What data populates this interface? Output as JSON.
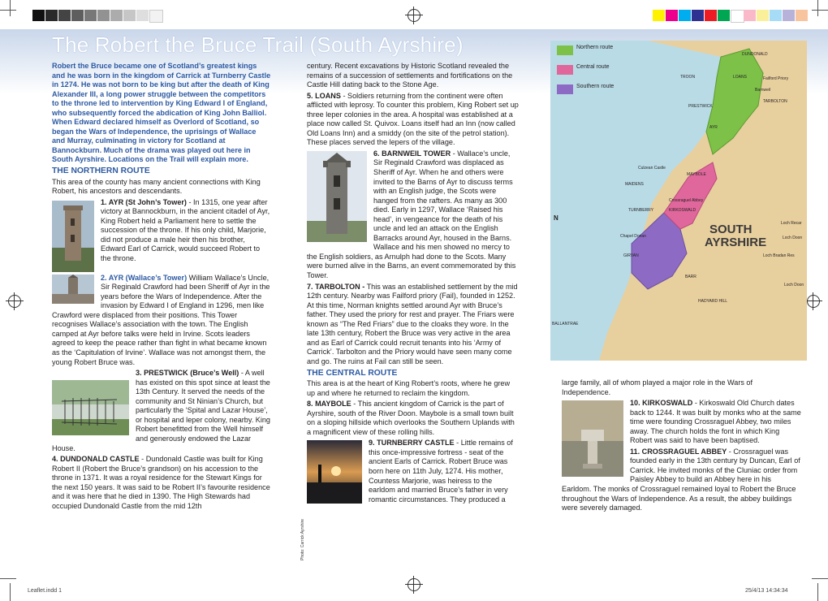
{
  "title": "The Robert the Bruce Trail (South Ayrshire)",
  "intro": "Robert the Bruce became one of Scotland’s greatest kings and he was born in the kingdom of Carrick at Turnberry Castle in 1274. He was not born to be king but after the death of King Alexander III, a long power struggle between the competitors to the throne led to intervention by King Edward I of England, who subsequently forced the abdication of King John Balliol. When Edward declared himself as Overlord of Scotland, so began the Wars of Independence, the uprisings of Wallace and Murray, culminating in victory for Scotland at Bannockburn. Much of the drama was played out here in South Ayrshire. Locations on the Trail will explain more.",
  "northern_heading": "THE NORTHERN ROUTE",
  "northern_intro": "This area of the county has many ancient connections with King Robert, his ancestors and descendants.",
  "ayr_title": "1. AYR (St John’s Tower)",
  "ayr_text": " - In 1315, one year after victory at Bannockburn, in the ancient citadel of Ayr, King Robert held a Parliament here to settle the succession of the throne. If his only child, Marjorie, did not produce a male heir then his brother, Edward Earl of Carrick, would succeed Robert to the throne.",
  "wallace_title": "2. AYR (Wallace’s Tower)",
  "wallace_text": " William Wallace’s Uncle, Sir Reginald Crawford had been Sheriff of Ayr in the years before the Wars of Independence. After the invasion by Edward I of England in 1296, men like Crawford were displaced from their positions. This Tower recognises Wallace’s association with the town. The English camped at Ayr before talks were held in Irvine. Scots leaders agreed to keep the peace rather than fight in what became known as the ‘Capitulation of Irvine’. Wallace was not amongst them, the young Robert Bruce was.",
  "prestwick_title": "3. PRESTWICK (Bruce’s Well)",
  "prestwick_text": " - A well has existed on this spot since at least the 13th Century. It served the needs of the community and St Ninian’s Church, but particularly the ‘Spital and Lazar House’, or hospital and leper colony, nearby. King Robert benefitted from the Well himself and generously endowed the Lazar House.",
  "dundonald_title": "4. DUNDONALD CASTLE",
  "dundonald_text": " - Dundonald Castle was built for King Robert II (Robert the Bruce’s grandson) on his accession to the throne in 1371. It was a royal residence for the Stewart Kings for the next 150 years. It was said to be Robert II’s favourite residence and it was here that he died in 1390. The High Stewards had occupied Dundonald Castle from the mid 12th",
  "col2_top": "century. Recent excavations by Historic Scotland revealed the remains of a succession of settlements and fortifications on the Castle Hill dating back to the Stone Age.",
  "loans_title": "5. LOANS",
  "loans_text": " - Soldiers returning from the continent were often afflicted with leprosy. To counter this problem, King Robert set up three leper colonies in the area. A hospital was established at a place now called St. Quivox. Loans itself had an Inn (now called Old Loans Inn) and a smiddy (on the site of the petrol station). These places served the lepers of the village.",
  "barnweil_title": "6. BARNWEIL TOWER",
  "barnweil_text": " - Wallace’s uncle, Sir Reginald Crawford was displaced as Sheriff of Ayr. When he and others were invited to the Barns of Ayr to discuss terms with an English judge, the Scots were hanged from the rafters. As many as 300 died. Early in 1297, Wallace ‘Raised his head’, in vengeance for the death of his uncle and led an attack on the English Barracks around Ayr, housed in the Barns. Wallace and his men showed no mercy to the English soldiers, as Arnulph had done to the Scots. Many were burned alive in the Barns, an event commemorated by this Tower.",
  "tarbolton_title": "7. TARBOLTON -",
  "tarbolton_text": " This was an established settlement by the mid 12th century. Nearby was Failford priory (Fail), founded in 1252. At this time, Norman knights settled around Ayr with Bruce’s father. They used the priory for rest and prayer. The Friars were known as “The Red Friars” due to the cloaks they wore. In the late 13th century, Robert the Bruce was very active in the area and as Earl of Carrick could recruit tenants into his ‘Army of Carrick’. Tarbolton and the Priory would have seen many come and go. The ruins at Fail can still be seen.",
  "central_heading": "THE CENTRAL ROUTE",
  "central_intro": "This area is at the heart of King Robert’s roots, where he grew up and where he returned to reclaim the kingdom.",
  "maybole_title": "8. MAYBOLE",
  "maybole_text": " - This ancient kingdom of Carrick is the part of Ayrshire, south of the River Doon. Maybole is a small town built on a sloping hillside which overlooks the Southern Uplands with a magnificent view of these rolling hills.",
  "turnberry_title": "9. TURNBERRY CASTLE",
  "turnberry_text": " - Little remains of this once-impressive fortress - seat of the ancient Earls of Carrick. Robert Bruce was born here on 11th July, 1274. His mother, Countess Marjorie, was heiress to the earldom and married Bruce’s father in very romantic circumstances. They produced a",
  "col3_top": "large family, all of whom played a major role in the Wars of Independence.",
  "kirkoswald_title": "10. KIRKOSWALD",
  "kirkoswald_text": " - Kirkoswald Old Church dates back to 1244. It was built by monks who at the same time were founding Crossraguel Abbey, two miles away. The church holds the font in which King Robert was said to have been baptised.",
  "crossraguel_title": "11. CROSSRAGUEL ABBEY",
  "crossraguel_text": " - Crossraguel was founded early in the 13th century by Duncan, Earl of Carrick. He invited monks of the Cluniac order from Paisley Abbey to build an Abbey here in his Earldom. The monks of Crossraguel remained loyal to Robert the Bruce throughout the Wars of Independence. As a result, the abbey buildings were severely damaged.",
  "photo_credit": "Photo: Carrick Ayrshire",
  "footer_left": "Leaflet.indd   1",
  "footer_right": "25/4/13   14:34:34",
  "map": {
    "legend_northern": "Northern route",
    "legend_central": "Central route",
    "legend_southern": "Southern route",
    "north_letter": "N",
    "region_label_1": "SOUTH",
    "region_label_2": "AYRSHIRE",
    "places": [
      "DUNDONALD",
      "TROON",
      "LOANS",
      "Barnweil",
      "Failford Priory",
      "TARBOLTON",
      "PRESTWICK",
      "AYR",
      "Culzean Castle",
      "MAYBOLE",
      "MAIDENS",
      "Crossraguel Abbey",
      "TURNBERRY",
      "KIRKOSWALD",
      "Chapel Donan",
      "GIRVAN",
      "Loch Doon",
      "Loch Bradan Res",
      "BARR",
      "HADYARD HILL",
      "BALLANTRAE",
      "Loch Recar",
      "Loch Doon"
    ]
  },
  "colors": {
    "northern": "#7dc148",
    "central": "#e0679b",
    "southern": "#8d6bc4",
    "land": "#e8cf9e",
    "sea": "#b9dbe6",
    "heading": "#2d5aa3"
  }
}
